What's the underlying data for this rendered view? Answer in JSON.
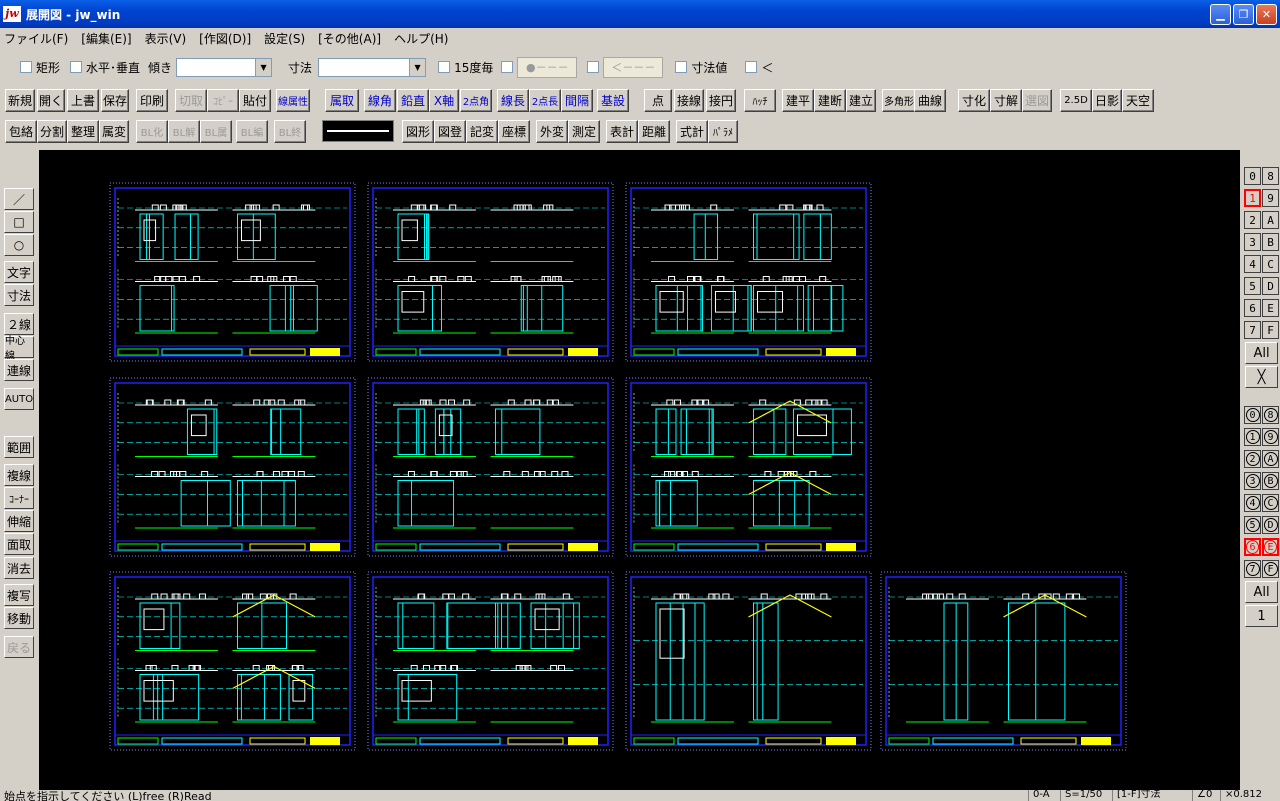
{
  "window": {
    "title": "展開図 - jw_win",
    "logo": "jw"
  },
  "menu": [
    "ファイル(F)",
    "[編集(E)]",
    "表示(V)",
    "[作図(D)]",
    "設定(S)",
    "[その他(A)]",
    "ヘルプ(H)"
  ],
  "toolbar1": {
    "rect_label": "矩形",
    "hv_label": "水平･垂直",
    "tilt_label": "傾き",
    "tilt_value": "",
    "dim_label": "寸法",
    "dim_value": "",
    "deg15_label": "15度毎",
    "seg1": "●－－－",
    "seg2": "＜－－－",
    "dimval_label": "寸法値",
    "lt_label": "＜"
  },
  "toolbar2": [
    "新規",
    "開く",
    "上書",
    "保存",
    "印刷",
    "切取",
    "ｺﾋﾟｰ",
    "貼付",
    "線属性",
    "属取",
    "線角",
    "鉛直",
    "X軸",
    "2点角",
    "線長",
    "2点長",
    "間隔",
    "基設",
    "点",
    "接線",
    "接円",
    "ﾊｯﾁ",
    "建平",
    "建断",
    "建立",
    "多角形",
    "曲線",
    "寸化",
    "寸解",
    "選図",
    "2.5D",
    "日影",
    "天空"
  ],
  "toolbar3": [
    "包絡",
    "分割",
    "整理",
    "属変",
    "BL化",
    "BL解",
    "BL属",
    "BL編",
    "BL終",
    "図形",
    "図登",
    "記変",
    "座標",
    "外変",
    "測定",
    "表計",
    "距離",
    "式計",
    "ﾊﾟﾗﾒ"
  ],
  "left_tools": [
    "／",
    "□",
    "○",
    "文字",
    "寸法",
    "２線",
    "中心線",
    "連線",
    "AUTO",
    "範囲",
    "複線",
    "ｺｰﾅｰ",
    "伸縮",
    "面取",
    "消去",
    "複写",
    "移動",
    "戻る"
  ],
  "layers": {
    "left": [
      "0",
      "1",
      "2",
      "3",
      "4",
      "5",
      "6",
      "7"
    ],
    "right": [
      "8",
      "9",
      "A",
      "B",
      "C",
      "D",
      "E",
      "F"
    ],
    "all": "All",
    "x": "╳",
    "groups_left": [
      "0",
      "1",
      "2",
      "3",
      "4",
      "5",
      "6",
      "7"
    ],
    "groups_right": [
      "8",
      "9",
      "A",
      "B",
      "C",
      "D",
      "E",
      "F"
    ],
    "all2": "All",
    "one": "1"
  },
  "status": {
    "message": "始点を指示してください (L)free (R)Read",
    "cells": [
      "0-A",
      "S=1/50",
      "[1-F]寸法",
      "∠0",
      "×0.812"
    ]
  },
  "colors": {
    "sheet_border": "#2020ff",
    "frame": "#8080ff",
    "cyan": "#00ffff",
    "yellow": "#ffff00",
    "green": "#00ff00",
    "white": "#ffffff"
  }
}
